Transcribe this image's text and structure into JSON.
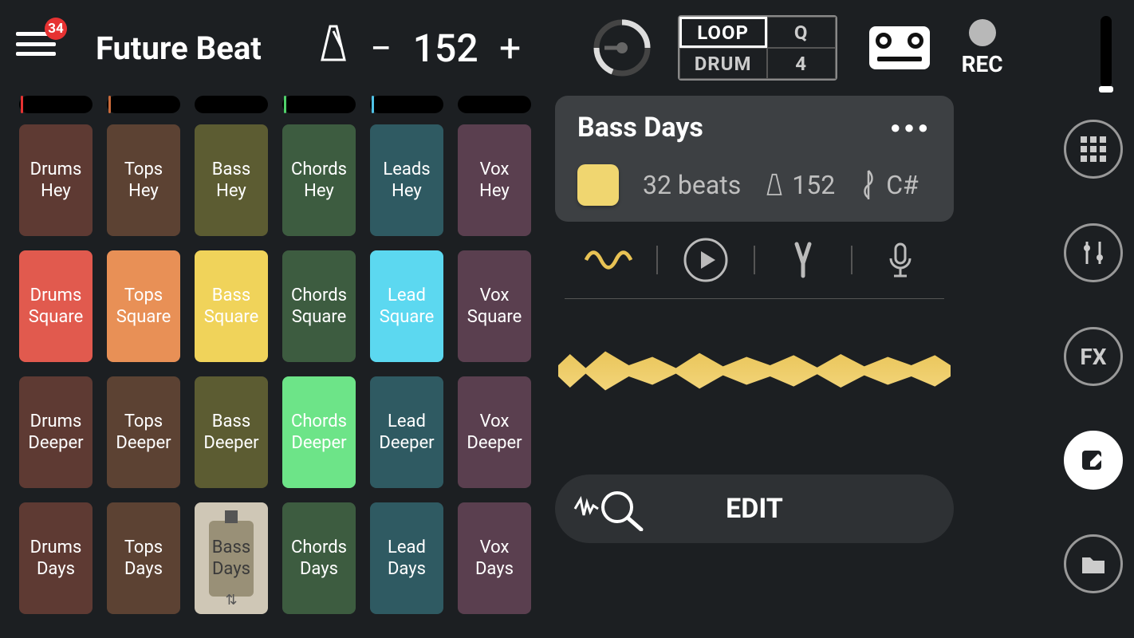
{
  "header": {
    "menu_badge": "34",
    "title": "Future Beat",
    "tempo_minus": "−",
    "tempo_value": "152",
    "tempo_plus": "+",
    "loop_label": "LOOP",
    "drum_label": "DRUM",
    "q_label": "Q",
    "q_value": "4",
    "rec_label": "REC"
  },
  "columns": [
    {
      "tick_color": "#e63232",
      "pads": [
        {
          "label": "Drums Hey",
          "bg": "#5e3a33"
        },
        {
          "label": "Drums Square",
          "bg": "#e15a4e"
        },
        {
          "label": "Drums Deeper",
          "bg": "#5e3a33"
        },
        {
          "label": "Drums Days",
          "bg": "#5e3a33"
        }
      ]
    },
    {
      "tick_color": "#c96a3a",
      "pads": [
        {
          "label": "Tops Hey",
          "bg": "#5c4233"
        },
        {
          "label": "Tops Square",
          "bg": "#e89056"
        },
        {
          "label": "Tops Deeper",
          "bg": "#5c4233"
        },
        {
          "label": "Tops Days",
          "bg": "#5c4233"
        }
      ]
    },
    {
      "tick_color": "",
      "pads": [
        {
          "label": "Bass Hey",
          "bg": "#5c5c32"
        },
        {
          "label": "Bass Square",
          "bg": "#f0d35a"
        },
        {
          "label": "Bass Deeper",
          "bg": "#5c5c32"
        },
        {
          "label": "Bass Days",
          "bg": "#cfc7b6",
          "selected": true
        }
      ]
    },
    {
      "tick_color": "#4fcf6a",
      "pads": [
        {
          "label": "Chords Hey",
          "bg": "#3d5c40"
        },
        {
          "label": "Chords Square",
          "bg": "#3d5c40"
        },
        {
          "label": "Chords Deeper",
          "bg": "#6de488"
        },
        {
          "label": "Chords Days",
          "bg": "#3d5c40"
        }
      ]
    },
    {
      "tick_color": "#4fc2e6",
      "pads": [
        {
          "label": "Leads Hey",
          "bg": "#2f5a62"
        },
        {
          "label": "Lead Square",
          "bg": "#5cd8f0"
        },
        {
          "label": "Lead Deeper",
          "bg": "#2f5a62"
        },
        {
          "label": "Lead Days",
          "bg": "#2f5a62"
        }
      ]
    },
    {
      "tick_color": "",
      "pads": [
        {
          "label": "Vox Hey",
          "bg": "#5a3f4f"
        },
        {
          "label": "Vox Square",
          "bg": "#5a3f4f"
        },
        {
          "label": "Vox Deeper",
          "bg": "#5a3f4f"
        },
        {
          "label": "Vox Days",
          "bg": "#5a3f4f"
        }
      ]
    }
  ],
  "detail": {
    "title": "Bass Days",
    "swatch_color": "#f0d670",
    "beats": "32 beats",
    "tempo": "152",
    "key": "C#",
    "edit_label": "EDIT"
  },
  "rail": {
    "fx_label": "FX"
  }
}
